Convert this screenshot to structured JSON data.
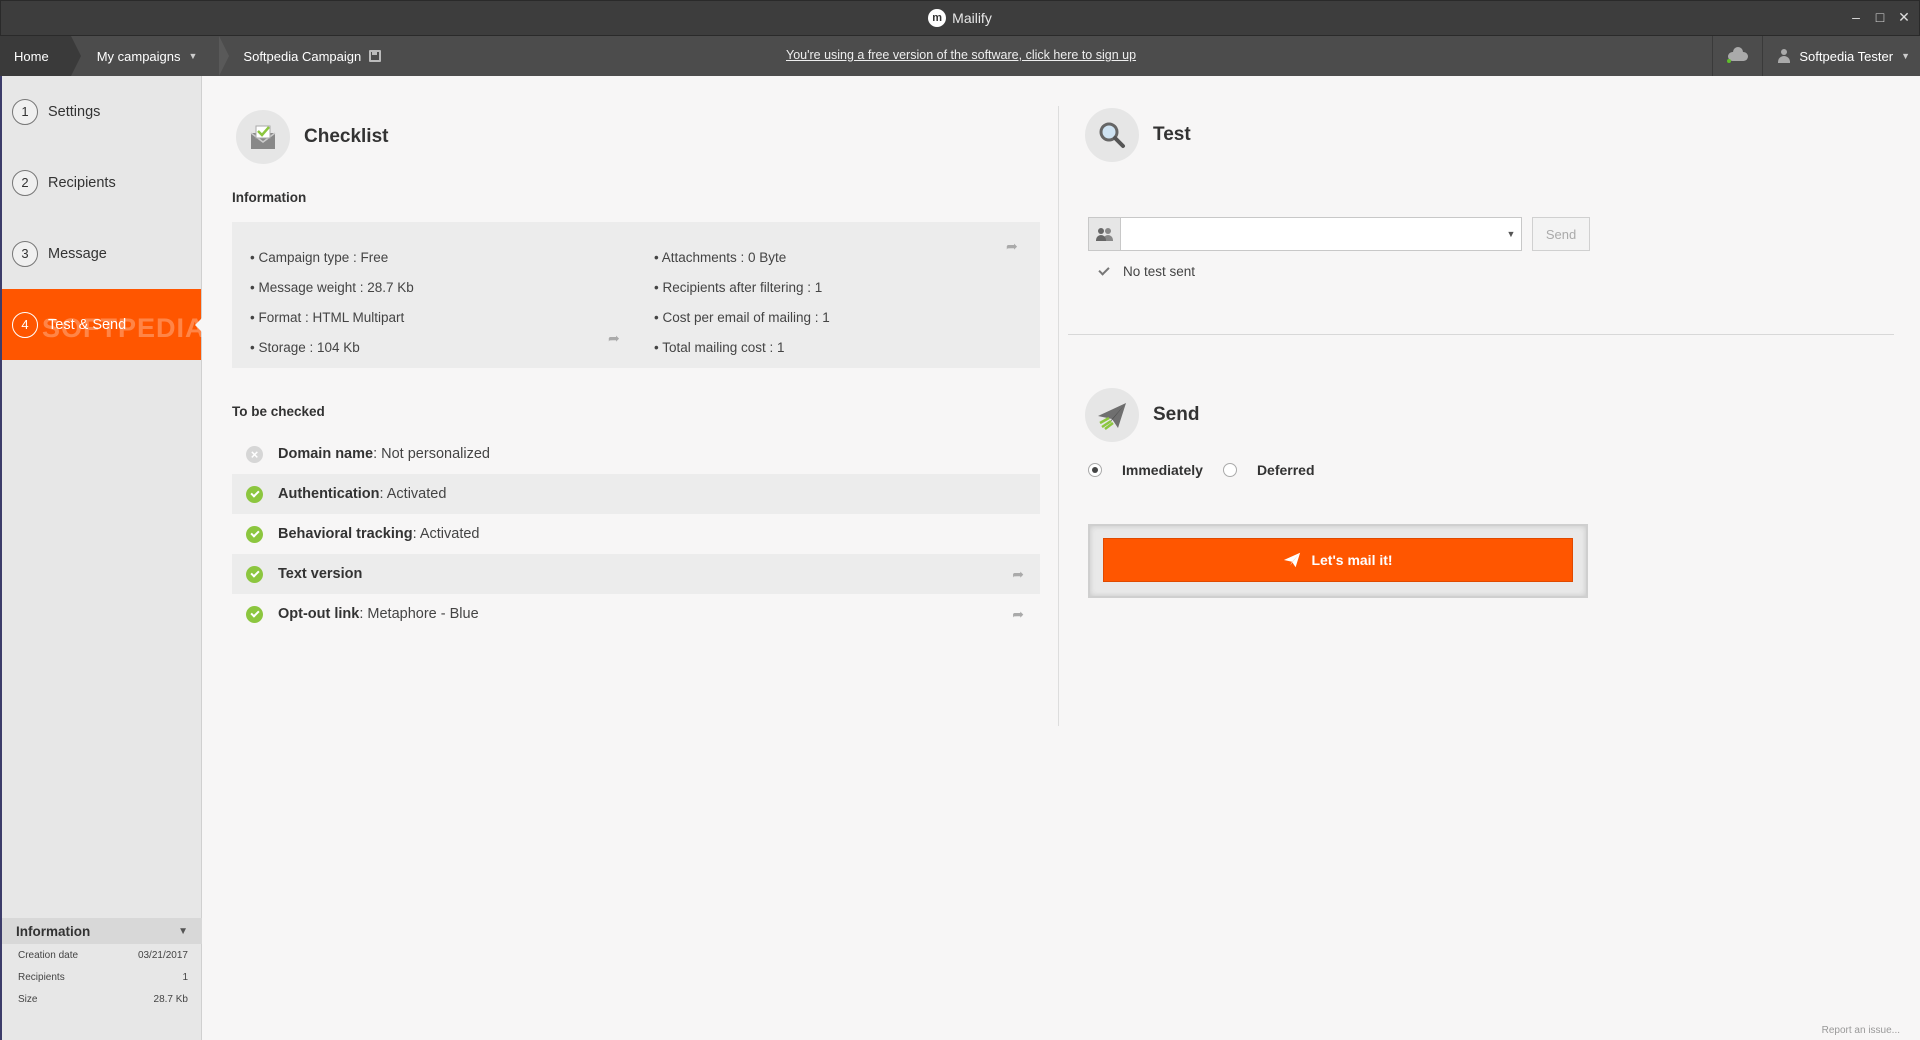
{
  "window": {
    "title": "Mailify",
    "logo_letter": "m",
    "controls": {
      "minimize": "‒",
      "maximize": "□",
      "close": "✕"
    }
  },
  "nav": {
    "home": "Home",
    "campaigns": "My campaigns",
    "current": "Softpedia Campaign",
    "free_notice": "You're using a free version of the software, click here to sign up",
    "user": "Softpedia Tester"
  },
  "sidebar": {
    "steps": [
      {
        "num": "1",
        "label": "Settings"
      },
      {
        "num": "2",
        "label": "Recipients"
      },
      {
        "num": "3",
        "label": "Message"
      },
      {
        "num": "4",
        "label": "Test & Send"
      }
    ],
    "watermark": "SOFTPEDIA",
    "info": {
      "title": "Information",
      "rows": [
        {
          "label": "Creation date",
          "value": "03/21/2017"
        },
        {
          "label": "Recipients",
          "value": "1"
        },
        {
          "label": "Size",
          "value": "28.7 Kb"
        }
      ]
    }
  },
  "checklist": {
    "title": "Checklist",
    "information_label": "Information",
    "info_left": [
      "• Campaign type : Free",
      "• Message weight : 28.7 Kb",
      "• Format : HTML Multipart",
      "• Storage : 104 Kb"
    ],
    "info_right": [
      "• Attachments : 0 Byte",
      "• Recipients after filtering : 1",
      "• Cost per email of mailing : 1",
      "• Total mailing cost : 1"
    ],
    "to_be_checked_label": "To be checked",
    "items": [
      {
        "name": "Domain name",
        "value": " : Not personalized",
        "status": "none"
      },
      {
        "name": "Authentication",
        "value": " : Activated",
        "status": "ok"
      },
      {
        "name": "Behavioral tracking",
        "value": " : Activated",
        "status": "ok"
      },
      {
        "name": "Text version",
        "value": "",
        "status": "ok"
      },
      {
        "name": "Opt-out link",
        "value": " : Metaphore - Blue",
        "status": "ok"
      }
    ]
  },
  "test": {
    "title": "Test",
    "email_value": "",
    "send_label": "Send",
    "status": "No test sent"
  },
  "send": {
    "title": "Send",
    "immediately": "Immediately",
    "deferred": "Deferred",
    "selected": "immediately",
    "button_label": "Let's mail it!"
  },
  "footer": {
    "report": "Report an issue..."
  },
  "colors": {
    "accent": "#ff5600",
    "ok": "#8cc63f",
    "nav": "#4c4c4c",
    "titlebar": "#3d3d3d"
  },
  "icons": [
    "mailify-logo-icon",
    "save-icon",
    "cloud-icon",
    "user-icon",
    "envelope-check-icon",
    "share-arrow-icon",
    "check-circle-icon",
    "cross-circle-icon",
    "magnifier-icon",
    "contacts-icon",
    "chevron-down-icon",
    "paper-plane-icon"
  ]
}
